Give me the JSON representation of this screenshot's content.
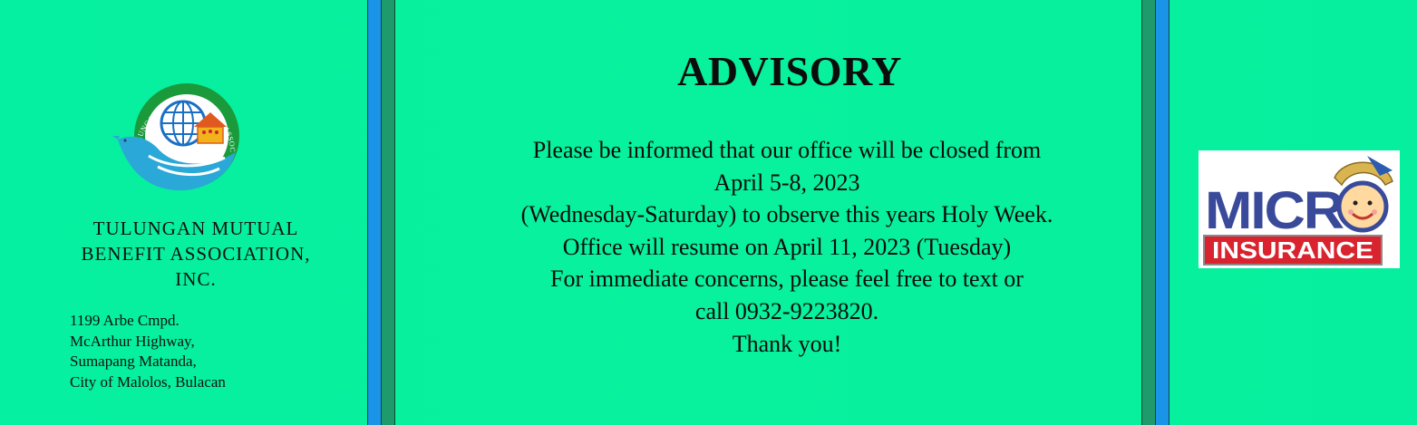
{
  "organization": {
    "name_lines": [
      "TULUNGAN MUTUAL",
      "BENEFIT ASSOCIATION,",
      "INC."
    ],
    "logo_ring_text": "TULUNGAN MUTUAL BENEFIT ASSOCIATION, INC.",
    "address_lines": [
      "1199 Arbe Cmpd.",
      "McArthur Highway,",
      "Sumapang Matanda,",
      "City of Malolos, Bulacan"
    ]
  },
  "advisory": {
    "title": "ADVISORY",
    "lines": [
      "Please be informed that our office will be closed from",
      "April 5-8, 2023",
      "(Wednesday-Saturday) to observe this years Holy Week.",
      "Office will resume on April 11, 2023 (Tuesday)",
      "For immediate concerns, please feel free to text or",
      "call 0932-9223820.",
      "Thank you!"
    ]
  },
  "micro_insurance_logo": {
    "top_text": "MICR",
    "bottom_text": "INSURANCE"
  },
  "colors": {
    "background": "#05f09d",
    "divider_blue": "#1a94e6",
    "divider_green": "#1e9b6d",
    "micro_blue": "#3a4a9a",
    "insurance_red": "#d9232e",
    "logo_green": "#1a9a3a",
    "logo_blue": "#1a6fc4"
  }
}
